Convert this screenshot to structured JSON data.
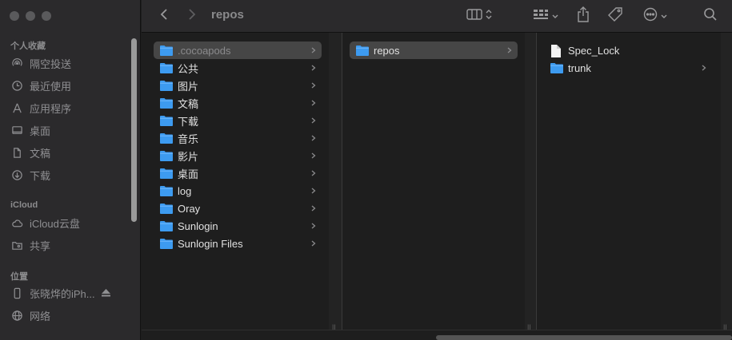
{
  "toolbar": {
    "title": "repos",
    "icons": [
      "back-icon",
      "forward-icon",
      "column-view-icon",
      "group-icon",
      "share-icon",
      "tag-icon",
      "more-icon",
      "search-icon"
    ]
  },
  "sidebar": {
    "favorites_header": "个人收藏",
    "favorites": [
      {
        "label": "隔空投送",
        "icon": "airdrop-icon"
      },
      {
        "label": "最近使用",
        "icon": "recents-icon"
      },
      {
        "label": "应用程序",
        "icon": "applications-icon"
      },
      {
        "label": "桌面",
        "icon": "desktop-icon"
      },
      {
        "label": "文稿",
        "icon": "documents-icon"
      },
      {
        "label": "下载",
        "icon": "downloads-icon"
      }
    ],
    "icloud_header": "iCloud",
    "icloud": [
      {
        "label": "iCloud云盘",
        "icon": "cloud-icon"
      },
      {
        "label": "共享",
        "icon": "shared-folder-icon"
      }
    ],
    "locations_header": "位置",
    "locations": [
      {
        "label": "张晓烨的iPh...",
        "icon": "phone-icon"
      },
      {
        "label": "网络",
        "icon": "network-icon"
      }
    ]
  },
  "columns": {
    "col1": [
      {
        "label": ".cocoapods",
        "selected": true,
        "dim": true
      },
      {
        "label": "公共"
      },
      {
        "label": "图片"
      },
      {
        "label": "文稿"
      },
      {
        "label": "下载"
      },
      {
        "label": "音乐"
      },
      {
        "label": "影片"
      },
      {
        "label": "桌面"
      },
      {
        "label": "log"
      },
      {
        "label": "Oray"
      },
      {
        "label": "Sunlogin"
      },
      {
        "label": "Sunlogin Files"
      }
    ],
    "col2": [
      {
        "label": "repos",
        "selected": true
      }
    ],
    "col3": [
      {
        "label": "Spec_Lock",
        "type": "file"
      },
      {
        "label": "trunk",
        "type": "folder"
      }
    ]
  },
  "colors": {
    "folder": "#3d9bf0",
    "sidebar_bg": "#2b2a2c",
    "content_bg": "#1e1e1e",
    "selection": "#464646"
  }
}
